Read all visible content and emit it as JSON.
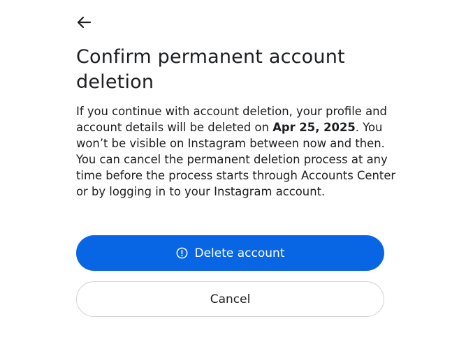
{
  "header": {
    "back_icon": "arrow-left-icon"
  },
  "dialog": {
    "title": "Confirm permanent account deletion",
    "body_part1": "If you continue with account deletion, your profile and account details will be deleted on ",
    "deletion_date": "Apr 25, 2025",
    "body_part2": ". You won’t be visible on Instagram between now and then. You can cancel the permanent deletion process at any time before the process starts through Accounts Center or by logging in to your Instagram account."
  },
  "actions": {
    "delete_label": "Delete account",
    "delete_icon": "alert-circle-icon",
    "cancel_label": "Cancel"
  },
  "colors": {
    "primary": "#0866e5",
    "text": "#1c1e21",
    "border": "#cfd3d8",
    "background": "#ffffff"
  }
}
